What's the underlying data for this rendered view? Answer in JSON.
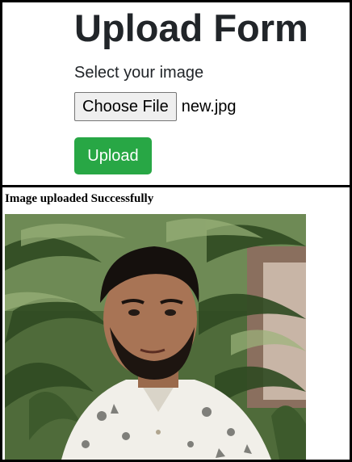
{
  "form": {
    "title": "Upload Form",
    "field_label": "Select your image",
    "choose_file_label": "Choose File",
    "selected_file": "new.jpg",
    "upload_label": "Upload"
  },
  "result": {
    "status_message": "Image uploaded Successfully",
    "image_description": "Uploaded photo of a young man with dark hair and beard wearing a white printed shirt, standing in front of palm plants"
  },
  "colors": {
    "upload_button": "#28a745",
    "text": "#212529"
  }
}
